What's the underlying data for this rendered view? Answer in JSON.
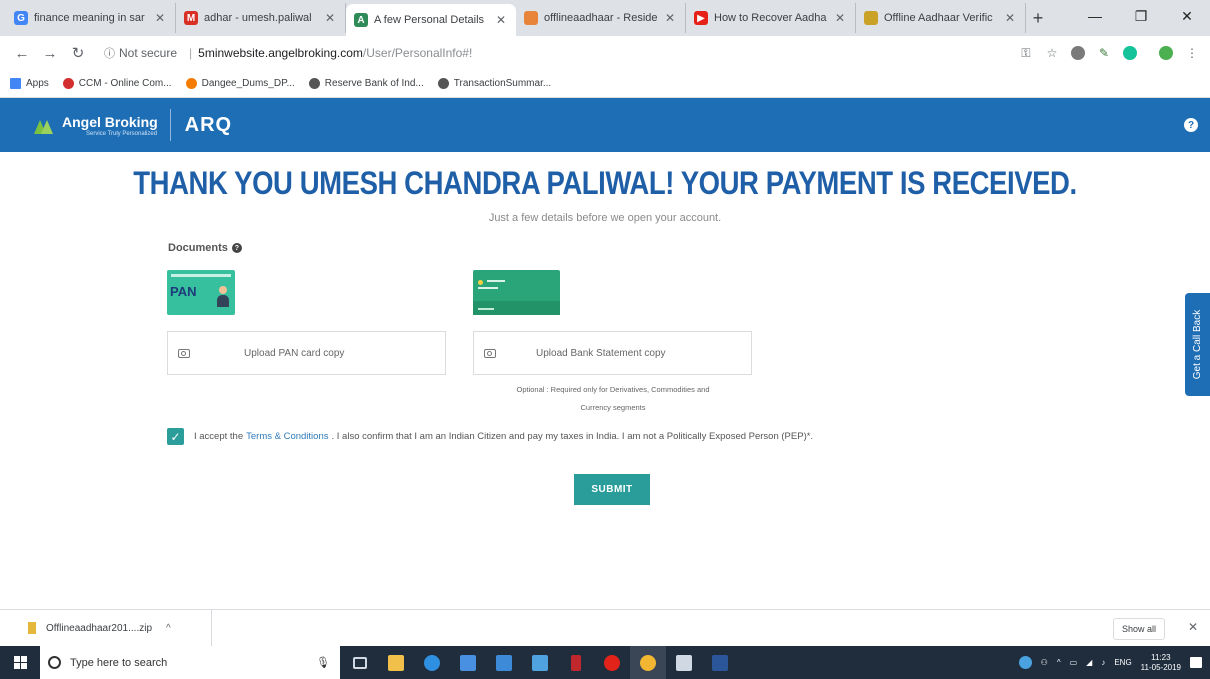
{
  "browser": {
    "tabs": [
      {
        "title": "finance meaning in sar",
        "favicon": "google-icon",
        "color": "#4285f4",
        "glyph": "G",
        "active": false
      },
      {
        "title": "adhar - umesh.paliwal",
        "favicon": "gmail-icon",
        "color": "#d93025",
        "glyph": "M",
        "active": false
      },
      {
        "title": "A few Personal Details",
        "favicon": "angel-icon",
        "color": "#2e8b57",
        "glyph": "A",
        "active": true
      },
      {
        "title": "offlineaadhaar - Reside",
        "favicon": "aadhaar-icon",
        "color": "#e8833a",
        "glyph": "",
        "active": false
      },
      {
        "title": "How to Recover Aadha",
        "favicon": "youtube-icon",
        "color": "#e62117",
        "glyph": "▶",
        "active": false
      },
      {
        "title": "Offline Aadhaar Verific",
        "favicon": "page-icon",
        "color": "#c9a227",
        "glyph": "",
        "active": false
      }
    ],
    "address": {
      "security": "Not secure",
      "host": "5minwebsite.angelbroking.com",
      "path": "/User/PersonalInfo#!"
    },
    "bookmarks": [
      {
        "label": "Apps",
        "color": "#4285f4"
      },
      {
        "label": "CCM - Online Com...",
        "color": "#d32f2f"
      },
      {
        "label": "Dangee_Dums_DP...",
        "color": "#f57c00"
      },
      {
        "label": "Reserve Bank of Ind...",
        "color": "#555555"
      },
      {
        "label": "TransactionSummar...",
        "color": "#555555"
      }
    ]
  },
  "site": {
    "brand": "Angel Broking",
    "tagline": "Service Truly Personalized",
    "product": "ARQ",
    "help_glyph": "?"
  },
  "page": {
    "heading": "THANK YOU UMESH CHANDRA PALIWAL! YOUR PAYMENT IS RECEIVED.",
    "subtitle": "Just a few details before we open your account.",
    "documents_label": "Documents",
    "pan_card_text": "PAN",
    "upload_pan": "Upload PAN card copy",
    "upload_bank": "Upload Bank Statement copy",
    "optional_note_1": "Optional : Required only for Derivatives, Commodities and",
    "optional_note_2": "Currency segments",
    "accept_prefix": "I accept the",
    "terms_link": "Terms & Conditions",
    "accept_suffix": ". I also confirm that I am an Indian Citizen and pay my taxes in India. I am not a Politically Exposed Person (PEP)*.",
    "accept_checked": true,
    "submit_label": "SUBMIT",
    "callback_label": "Get a Call Back"
  },
  "downloads": {
    "file": "Offlineaadhaar201....zip",
    "show_all": "Show all"
  },
  "taskbar": {
    "search_placeholder": "Type here to search",
    "language": "ENG",
    "time": "11:23",
    "date": "11-05-2019"
  },
  "colors": {
    "brand_blue": "#1e6eb6",
    "heading_blue": "#1e5fa8",
    "accent_teal": "#2a9d9a"
  }
}
